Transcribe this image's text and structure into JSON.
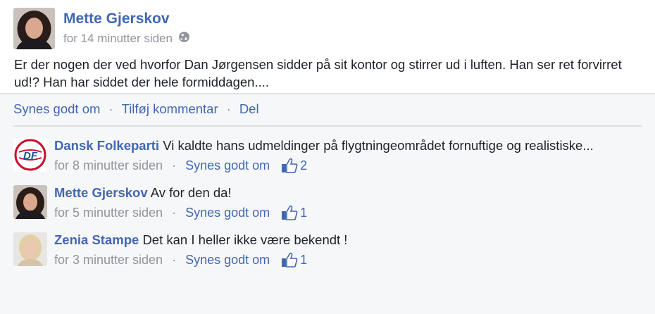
{
  "post": {
    "author": "Mette Gjerskov",
    "timestamp": "for 14 minutter siden",
    "text": "Er der nogen der ved hvorfor Dan Jørgensen sidder på sit kontor og stirrer ud i luften. Han ser ret forvirret ud!? Han har siddet der hele formiddagen....",
    "actions": {
      "like": "Synes godt om",
      "comment": "Tilføj kommentar",
      "share": "Del",
      "separator": "·"
    }
  },
  "comments": [
    {
      "author": "Dansk Folkeparti",
      "text": "Vi kaldte hans udmeldinger på flygtningeområdet fornuftige og realistiske...",
      "timestamp": "for 8 minutter siden",
      "like_label": "Synes godt om",
      "like_count": "2",
      "logo_text": "DF"
    },
    {
      "author": "Mette Gjerskov",
      "text": "Av for den da!",
      "timestamp": "for 5 minutter siden",
      "like_label": "Synes godt om",
      "like_count": "1"
    },
    {
      "author": "Zenia Stampe",
      "text": "Det kan I heller ikke være bekendt !",
      "timestamp": "for 3 minutter siden",
      "like_label": "Synes godt om",
      "like_count": "1"
    }
  ],
  "colors": {
    "link": "#4267b2",
    "meta": "#90949c",
    "background": "#f6f7f9"
  },
  "icons": [
    "globe-icon",
    "thumbs-up-icon"
  ]
}
